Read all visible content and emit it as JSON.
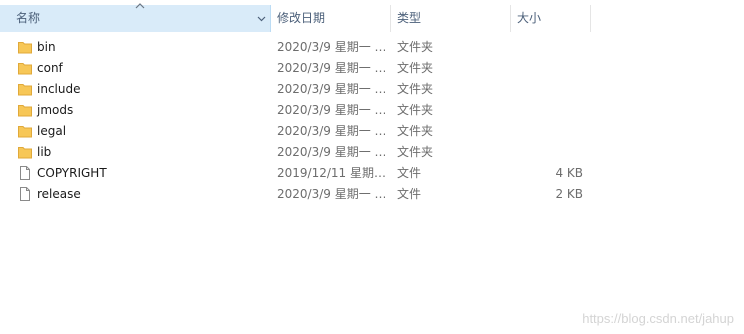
{
  "columns": {
    "name": "名称",
    "date": "修改日期",
    "type": "类型",
    "size": "大小"
  },
  "colors": {
    "header_selected_bg": "#d9ebf9",
    "header_text": "#4c607a",
    "folder_yellow": "#f7c757",
    "detail_text": "#6d6d6d"
  },
  "files": [
    {
      "name": "bin",
      "date": "2020/3/9 星期一 …",
      "type": "文件夹",
      "size": "",
      "icon": "folder-icon"
    },
    {
      "name": "conf",
      "date": "2020/3/9 星期一 …",
      "type": "文件夹",
      "size": "",
      "icon": "folder-icon"
    },
    {
      "name": "include",
      "date": "2020/3/9 星期一 …",
      "type": "文件夹",
      "size": "",
      "icon": "folder-icon"
    },
    {
      "name": "jmods",
      "date": "2020/3/9 星期一 …",
      "type": "文件夹",
      "size": "",
      "icon": "folder-icon"
    },
    {
      "name": "legal",
      "date": "2020/3/9 星期一 …",
      "type": "文件夹",
      "size": "",
      "icon": "folder-icon"
    },
    {
      "name": "lib",
      "date": "2020/3/9 星期一 …",
      "type": "文件夹",
      "size": "",
      "icon": "folder-icon"
    },
    {
      "name": "COPYRIGHT",
      "date": "2019/12/11 星期…",
      "type": "文件",
      "size": "4 KB",
      "icon": "file-icon"
    },
    {
      "name": "release",
      "date": "2020/3/9 星期一 …",
      "type": "文件",
      "size": "2 KB",
      "icon": "file-icon"
    }
  ],
  "watermark": "https://blog.csdn.net/jahup"
}
